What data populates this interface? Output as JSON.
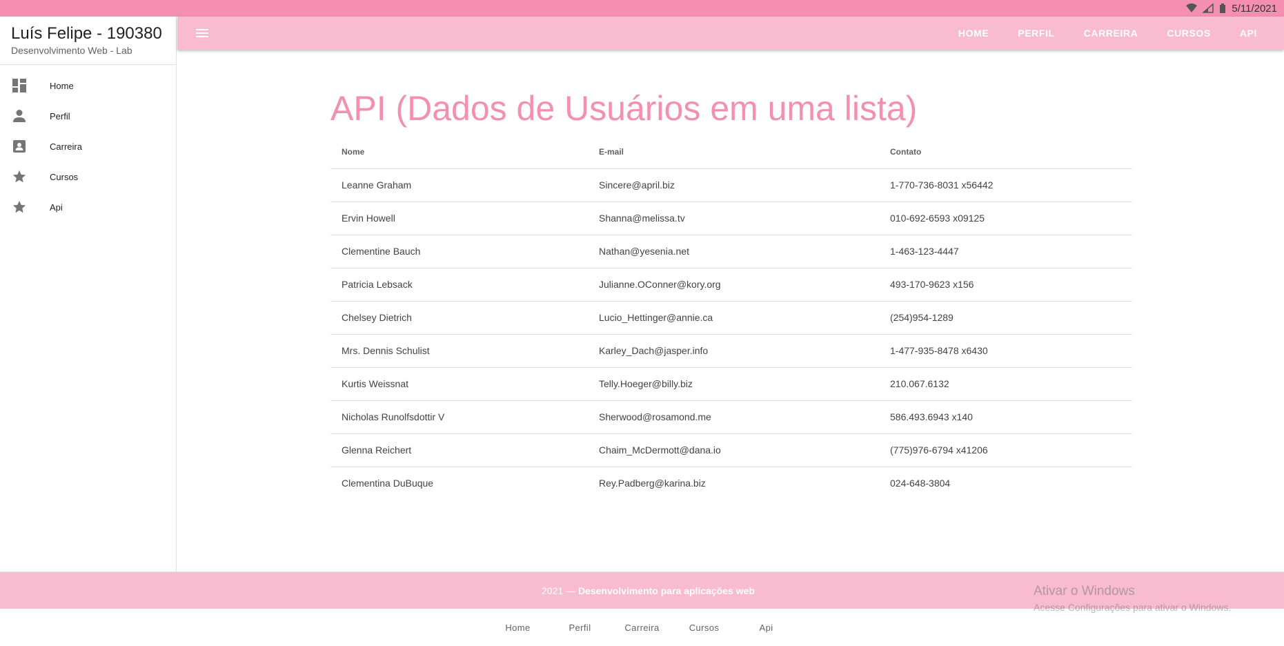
{
  "status": {
    "date": "5/11/2021"
  },
  "drawer": {
    "title": "Luís Felipe - 190380",
    "subtitle": "Desenvolvimento Web - Lab",
    "items": [
      {
        "label": "Home",
        "icon": "dashboard-icon"
      },
      {
        "label": "Perfil",
        "icon": "person-icon"
      },
      {
        "label": "Carreira",
        "icon": "contact-card-icon"
      },
      {
        "label": "Cursos",
        "icon": "star-icon"
      },
      {
        "label": "Api",
        "icon": "star-icon"
      }
    ]
  },
  "appbar": {
    "nav": [
      "HOME",
      "PERFIL",
      "CARREIRA",
      "CURSOS",
      "API"
    ]
  },
  "main": {
    "title": "API (Dados de Usuários em uma lista)",
    "table": {
      "headers": [
        "Nome",
        "E-mail",
        "Contato"
      ],
      "rows": [
        [
          "Leanne Graham",
          "Sincere@april.biz",
          "1-770-736-8031 x56442"
        ],
        [
          "Ervin Howell",
          "Shanna@melissa.tv",
          "010-692-6593 x09125"
        ],
        [
          "Clementine Bauch",
          "Nathan@yesenia.net",
          "1-463-123-4447"
        ],
        [
          "Patricia Lebsack",
          "Julianne.OConner@kory.org",
          "493-170-9623 x156"
        ],
        [
          "Chelsey Dietrich",
          "Lucio_Hettinger@annie.ca",
          "(254)954-1289"
        ],
        [
          "Mrs. Dennis Schulist",
          "Karley_Dach@jasper.info",
          "1-477-935-8478 x6430"
        ],
        [
          "Kurtis Weissnat",
          "Telly.Hoeger@billy.biz",
          "210.067.6132"
        ],
        [
          "Nicholas Runolfsdottir V",
          "Sherwood@rosamond.me",
          "586.493.6943 x140"
        ],
        [
          "Glenna Reichert",
          "Chaim_McDermott@dana.io",
          "(775)976-6794 x41206"
        ],
        [
          "Clementina DuBuque",
          "Rey.Padberg@karina.biz",
          "024-648-3804"
        ]
      ]
    }
  },
  "footer": {
    "year": "2021 —",
    "text": "Desenvolvimento para aplicações web",
    "watermark_title": "Ativar o Windows",
    "watermark_sub": "Acesse Configurações para ativar o Windows."
  },
  "bottom_nav": [
    "Home",
    "Perfil",
    "Carreira",
    "Cursos",
    "Api"
  ],
  "colors": {
    "primary": "#f8bbd0",
    "accent": "#f48fb1"
  }
}
